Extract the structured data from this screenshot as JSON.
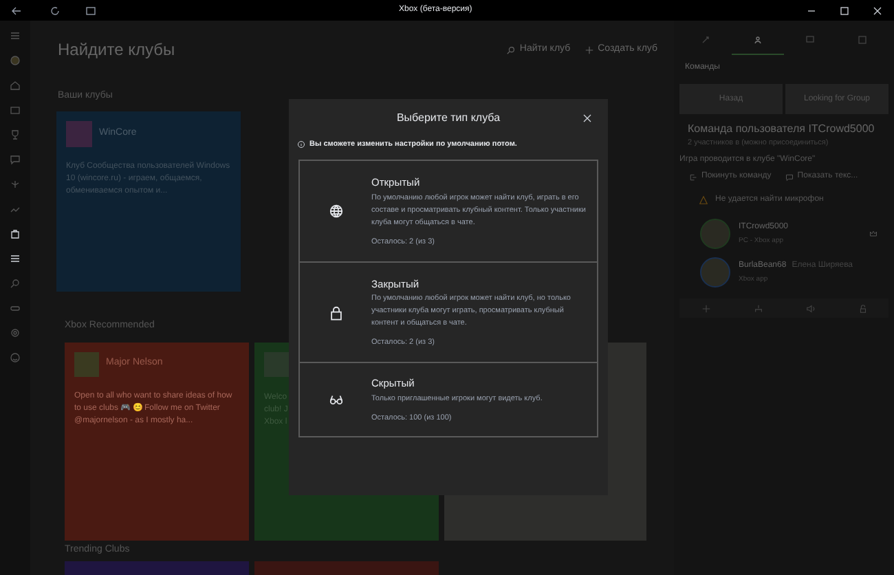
{
  "window": {
    "title": "Xbox (бета-версия)"
  },
  "nav": {
    "items": [
      {
        "selected": false
      },
      {
        "selected": false
      },
      {
        "selected": false
      },
      {
        "selected": false
      },
      {
        "selected": false
      },
      {
        "selected": false
      },
      {
        "selected": false
      },
      {
        "selected": false
      },
      {
        "selected": true
      },
      {
        "selected": false
      },
      {
        "selected": false
      },
      {
        "selected": false
      },
      {
        "selected": false
      }
    ]
  },
  "main": {
    "heading": "Найдите клубы",
    "actions": [
      {
        "kind": "search",
        "label": "Найти клуб"
      },
      {
        "kind": "add",
        "label": "Создать клуб"
      }
    ],
    "your_clubs": {
      "heading": "Ваши клубы",
      "clubs": [
        {
          "name": "WinCore",
          "description": "Клуб Сообщества пользователей Windows 10 (wincore.ru) - играем, общаемся, обмениваемся опытом и..."
        }
      ]
    },
    "recommended": {
      "heading": "Xbox Recommended",
      "clubs": [
        {
          "name": "Major Nelson",
          "description": "Open to all who want to share ideas of how to use clubs 🎮 😊 Follow me on Twitter @majornelson - as I mostly ha...",
          "color": "#4a1a12"
        },
        {
          "description_lines": [
            "Welco",
            "club! J",
            "Xbox l"
          ],
          "color": "#17361a"
        },
        {
          "color": "#2e2e2c"
        }
      ]
    },
    "trending": {
      "heading": "Trending Clubs"
    }
  },
  "dialog": {
    "title": "Выберите тип клуба",
    "note": "Вы сможете изменить настройки по умолчанию потом.",
    "options": [
      {
        "kind": "open",
        "title": "Открытый",
        "description": "По умолчанию любой игрок может найти клуб, играть в его составе и просматривать клубный контент. Только участники клуба могут общаться в чате.",
        "remaining": "Осталось: 2 (из 3)"
      },
      {
        "kind": "closed",
        "title": "Закрытый",
        "description": "По умолчанию любой игрок может найти клуб, но только участники клуба могут играть, просматривать клубный контент и общаться в чате.",
        "remaining": "Осталось: 2 (из 3)"
      },
      {
        "kind": "hidden",
        "title": "Скрытый",
        "description": "Только приглашенные игроки могут видеть клуб.",
        "remaining": "Осталось: 100 (из 100)"
      }
    ]
  },
  "right_panel": {
    "tabs": [
      {
        "selected": false
      },
      {
        "selected": true
      },
      {
        "selected": false
      },
      {
        "selected": false
      }
    ],
    "section": "Команды",
    "buttons": [
      "Назад",
      "Looking for Group"
    ],
    "team": {
      "title": "Команда пользователя ITCrowd5000",
      "subtitle": "2 участников в (можно присоединиться)",
      "club_line": "Игра проводится в клубе \"WinCore\"",
      "actions": [
        {
          "kind": "leave",
          "label": "Покинуть команду"
        },
        {
          "kind": "text",
          "label": "Показать текс..."
        }
      ],
      "warning": "Не удается найти микрофон",
      "members": [
        {
          "name": "ITCrowd5000",
          "platform": "PC - Xbox app",
          "leader": true
        },
        {
          "name": "BurlaBean68",
          "real_name": "Елена Ширяева",
          "platform": "Xbox app",
          "leader": false
        }
      ]
    }
  }
}
